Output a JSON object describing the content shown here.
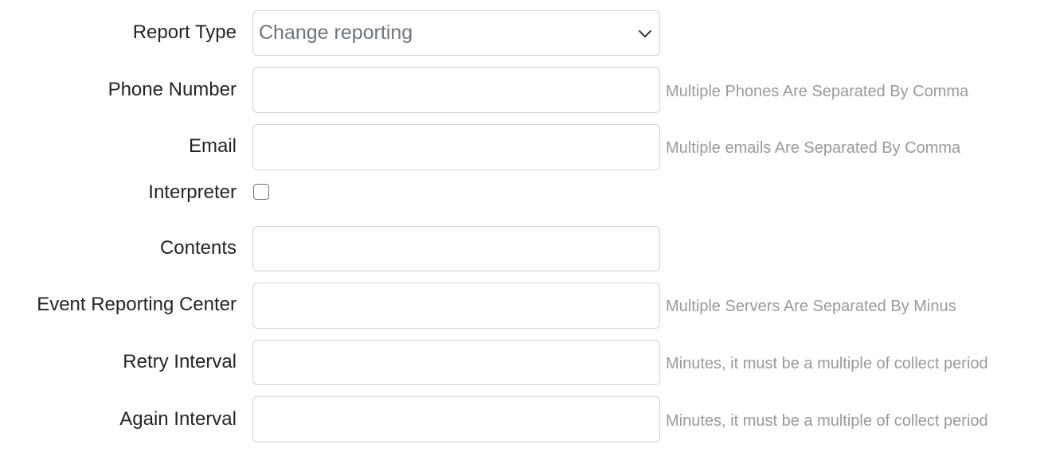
{
  "form": {
    "report_type": {
      "label": "Report Type",
      "selected": "Change reporting"
    },
    "phone_number": {
      "label": "Phone Number",
      "value": "",
      "hint": "Multiple Phones Are Separated By Comma"
    },
    "email": {
      "label": "Email",
      "value": "",
      "hint": "Multiple emails Are Separated By Comma"
    },
    "interpreter": {
      "label": "Interpreter",
      "checked": false
    },
    "contents": {
      "label": "Contents",
      "value": ""
    },
    "event_reporting_center": {
      "label": "Event Reporting Center",
      "value": "",
      "hint": "Multiple Servers Are Separated By Minus"
    },
    "retry_interval": {
      "label": "Retry Interval",
      "value": "",
      "hint": "Minutes, it must be a multiple of collect period"
    },
    "again_interval": {
      "label": "Again Interval",
      "value": "",
      "hint": "Minutes, it must be a multiple of collect period"
    }
  },
  "icons": {
    "select_arrow": "chevron-down-icon"
  },
  "colors": {
    "label_text": "#212529",
    "hint_text": "#9a9a9a",
    "border": "#ced4da",
    "placeholder": "#6c757d"
  }
}
